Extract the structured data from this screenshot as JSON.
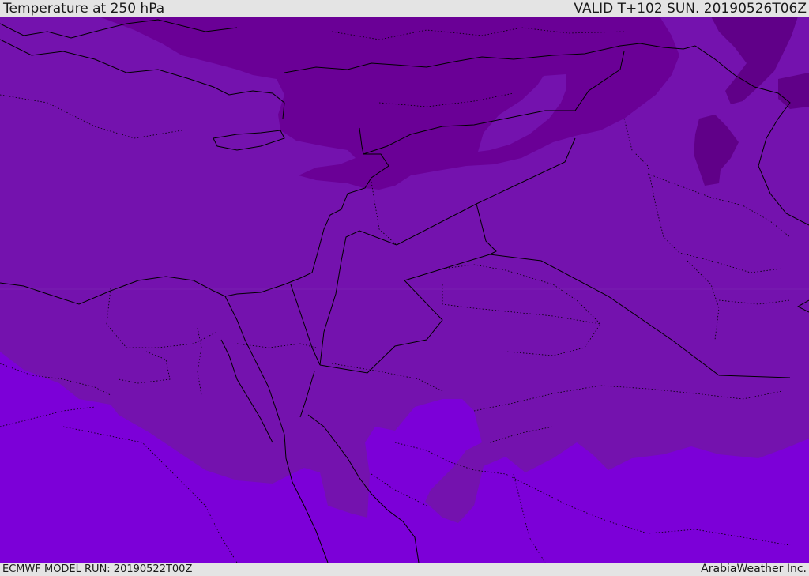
{
  "header": {
    "title": "Temperature at 250 hPa",
    "valid": "VALID T+102 SUN. 20190526T06Z"
  },
  "footer": {
    "model_run": "ECMWF MODEL RUN: 20190522T00Z",
    "credit": "ArabiaWeather Inc."
  },
  "map": {
    "field_colors": {
      "warm": "#7c00d8",
      "mid": "#7412ae",
      "cool": "#6a0096",
      "coolest": "#5a0080"
    },
    "border_color": "#000000"
  }
}
